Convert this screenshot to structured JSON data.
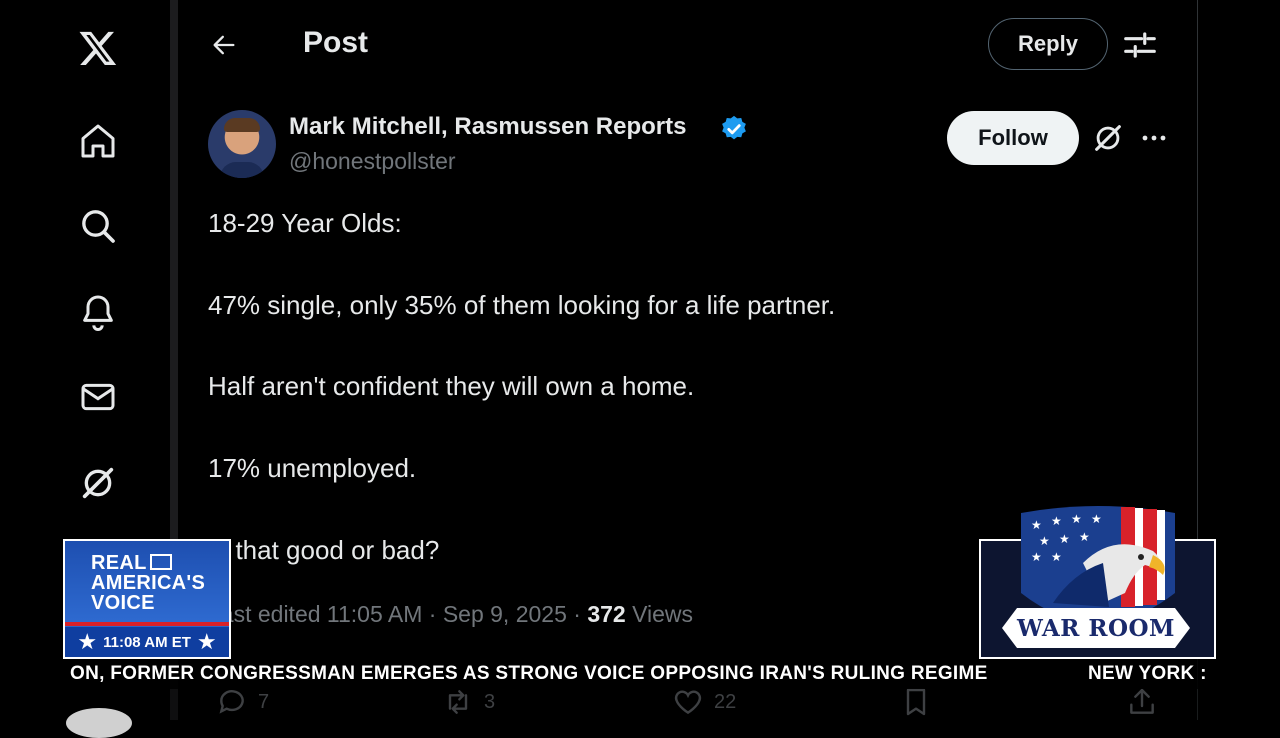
{
  "header": {
    "title": "Post",
    "reply_label": "Reply"
  },
  "sidebar": {
    "items": [
      "x-logo-icon",
      "home-icon",
      "search-icon",
      "bell-icon",
      "mail-icon",
      "grok-icon"
    ]
  },
  "post": {
    "author_name": "Mark Mitchell, Rasmussen Reports",
    "author_handle": "@honestpollster",
    "follow_label": "Follow",
    "lines": [
      "18-29 Year Olds:",
      "47% single, only 35% of them looking for a life partner.",
      "Half aren't confident they will own a home.",
      "17% unemployed.",
      "Is that good or bad?"
    ],
    "meta_prefix": "Last edited 11:05 AM · Sep 9, 2025 · ",
    "views_count": "372",
    "views_label": " Views",
    "counts": {
      "replies": "7",
      "reposts": "3",
      "likes": "22"
    }
  },
  "overlay": {
    "rav": {
      "line1": "REAL",
      "line2": "AMERICA'S",
      "line3": "VOICE",
      "time": "11:08 AM ET"
    },
    "warroom": {
      "label": "WAR ROOM"
    },
    "ticker": {
      "headline": "ON, FORMER CONGRESSMAN EMERGES AS STRONG VOICE OPPOSING IRAN'S RULING REGIME",
      "next": "NEW YORK :"
    }
  },
  "colors": {
    "accent_blue": "#1d9bf0",
    "text": "#e7e9ea",
    "muted": "#71767b"
  }
}
